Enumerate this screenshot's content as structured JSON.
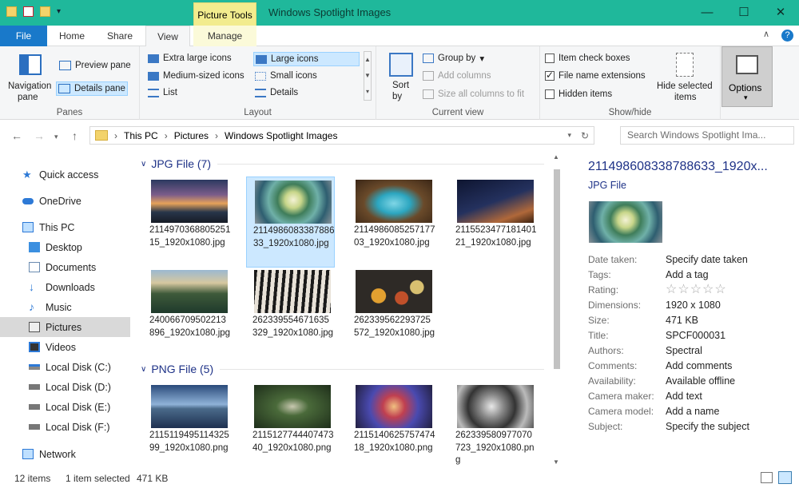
{
  "window": {
    "title": "Windows Spotlight Images",
    "context_tab": "Picture Tools",
    "accent": "#1fb89b"
  },
  "controls": {
    "minimize": "—",
    "maximize": "☐",
    "close": "✕"
  },
  "tabs": {
    "file": "File",
    "home": "Home",
    "share": "Share",
    "view": "View",
    "manage": "Manage"
  },
  "ribbon": {
    "panes": {
      "navigation": "Navigation",
      "navigation2": "pane",
      "preview": "Preview pane",
      "details": "Details pane",
      "label": "Panes"
    },
    "layout": {
      "xl": "Extra large icons",
      "large": "Large icons",
      "medium": "Medium-sized icons",
      "small": "Small icons",
      "list": "List",
      "details": "Details",
      "label": "Layout"
    },
    "view": {
      "sort": "Sort",
      "sort2": "by",
      "group": "Group by",
      "add_cols": "Add columns",
      "size_cols": "Size all columns to fit",
      "label": "Current view"
    },
    "showhide": {
      "item_cb": "Item check boxes",
      "ext": "File name extensions",
      "hidden": "Hidden items",
      "hide_sel": "Hide selected",
      "hide_sel2": "items",
      "label": "Show/hide"
    },
    "options": "Options"
  },
  "address": {
    "parts": [
      "This PC",
      "Pictures",
      "Windows Spotlight Images"
    ],
    "search_placeholder": "Search Windows Spotlight Ima..."
  },
  "nav": {
    "quick": "Quick access",
    "onedrive": "OneDrive",
    "thispc": "This PC",
    "desktop": "Desktop",
    "documents": "Documents",
    "downloads": "Downloads",
    "music": "Music",
    "pictures": "Pictures",
    "videos": "Videos",
    "c": "Local Disk (C:)",
    "d": "Local Disk (D:)",
    "e": "Local Disk (E:)",
    "f": "Local Disk (F:)",
    "network": "Network"
  },
  "groups": {
    "jpg": "JPG File (7)",
    "png": "PNG File (5)"
  },
  "files": [
    "211497036880525115_1920x1080.jpg",
    "211498608338788633_1920x1080.jpg",
    "211498608525717703_1920x1080.jpg",
    "211552347718140121_1920x1080.jpg",
    "240066709502213896_1920x1080.jpg",
    "262339554671635329_1920x1080.jpg",
    "262339562293725572_1920x1080.jpg",
    "211511949511432599_1920x1080.png",
    "211512774440747340_1920x1080.png",
    "211514062575747418_1920x1080.png",
    "262339580977070723_1920x1080.png"
  ],
  "details": {
    "title": "211498608338788633_1920x...",
    "type": "JPG File",
    "props": [
      [
        "Date taken:",
        "Specify date taken"
      ],
      [
        "Tags:",
        "Add a tag"
      ],
      [
        "Rating:",
        "☆☆☆☆☆"
      ],
      [
        "Dimensions:",
        "1920 x 1080"
      ],
      [
        "Size:",
        "471 KB"
      ],
      [
        "Title:",
        "SPCF000031"
      ],
      [
        "Authors:",
        "Spectral"
      ],
      [
        "Comments:",
        "Add comments"
      ],
      [
        "Availability:",
        "Available offline"
      ],
      [
        "Camera maker:",
        "Add text"
      ],
      [
        "Camera model:",
        "Add a name"
      ],
      [
        "Subject:",
        "Specify the subject"
      ]
    ]
  },
  "status": {
    "count": "12 items",
    "selected": "1 item selected",
    "size": "471 KB"
  }
}
